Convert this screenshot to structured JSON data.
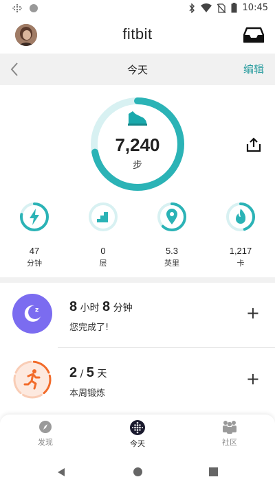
{
  "status": {
    "time": "10:45"
  },
  "app": {
    "title": "fitbit"
  },
  "date_bar": {
    "title": "今天",
    "edit": "编辑"
  },
  "steps": {
    "value": "7,240",
    "unit": "步",
    "progress": 0.72
  },
  "stats": [
    {
      "value": "47",
      "unit": "分钟",
      "icon": "lightning-icon",
      "progress": 0.78
    },
    {
      "value": "0",
      "unit": "层",
      "icon": "stairs-icon",
      "progress": 0.0
    },
    {
      "value": "5.3",
      "unit": "英里",
      "icon": "location-pin-icon",
      "progress": 0.62
    },
    {
      "value": "1,217",
      "unit": "卡",
      "icon": "flame-icon",
      "progress": 0.45
    }
  ],
  "sleep": {
    "hours": "8",
    "hours_unit": "小时",
    "minutes": "8",
    "minutes_unit": "分钟",
    "sub": "您完成了!",
    "plus": "+"
  },
  "exercise": {
    "done": "2",
    "sep": "/",
    "goal": "5",
    "unit": "天",
    "sub": "本周锻炼",
    "plus": "+",
    "progress": 0.4
  },
  "nav": {
    "discover": "发现",
    "today": "今天",
    "community": "社区"
  },
  "colors": {
    "teal": "#2bb3b6",
    "teal_light": "#d8f1f2",
    "sleep": "#7b6cf0",
    "exercise": "#f26b2a",
    "link": "#2a9d9f"
  }
}
